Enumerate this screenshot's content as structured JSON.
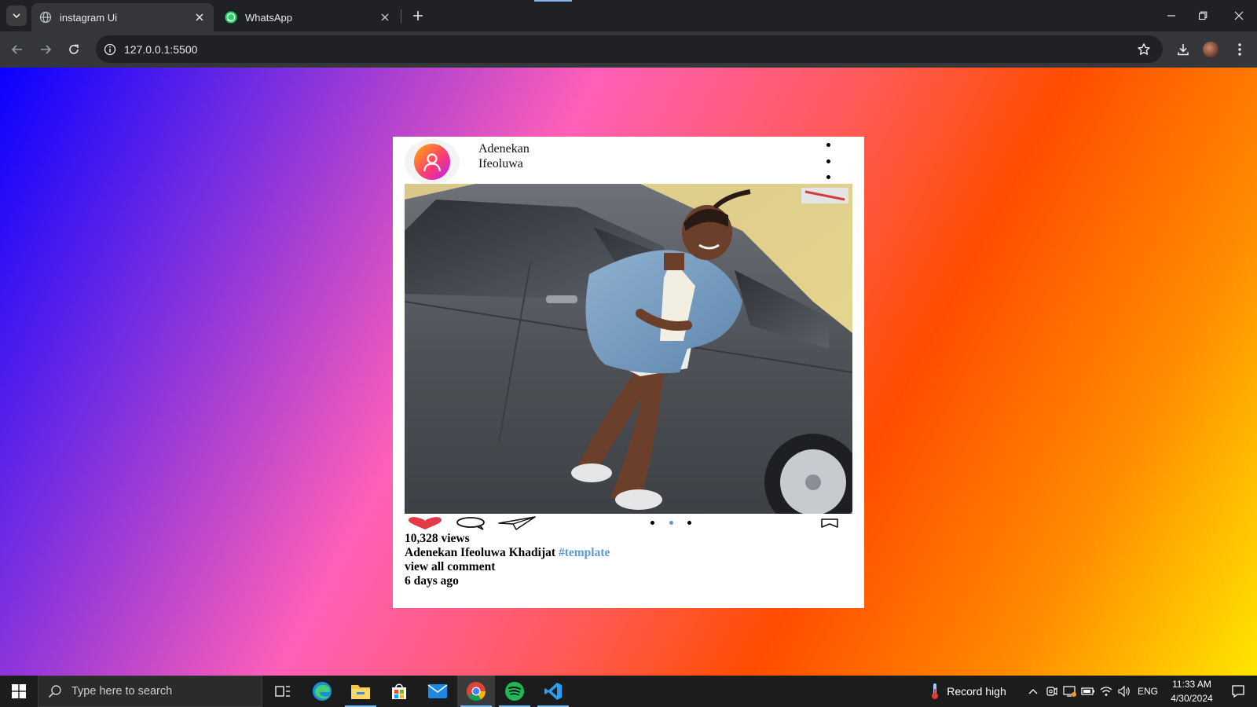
{
  "browser": {
    "tabs": [
      {
        "title": "instagram Ui",
        "active": true,
        "favicon": "globe-icon"
      },
      {
        "title": "WhatsApp",
        "active": false,
        "favicon": "whatsapp-icon"
      }
    ],
    "url": "127.0.0.1:5500"
  },
  "post": {
    "username_line1": "Adenekan",
    "username_line2": "Ifeoluwa",
    "views": "10,328 views",
    "caption_name": "Adenekan Ifeoluwa Khadijat",
    "caption_tag": "#template",
    "view_comments": "view all comment",
    "time_ago": "6 days ago",
    "carousel": {
      "count": 3,
      "active_index": 1
    },
    "photo_description_icon": "photo-of-person-leaning-on-car",
    "colors": {
      "heart": "#e63946",
      "tag": "#5b9bd5"
    }
  },
  "taskbar": {
    "search_placeholder": "Type here to search",
    "weather_text": "Record high",
    "language": "ENG",
    "time": "11:33 AM",
    "date": "4/30/2024"
  },
  "colors": {
    "gradient": [
      "#0a00ff",
      "#7a2fe0",
      "#ff5fb7",
      "#ff4d00",
      "#ff8a00",
      "#ffe600"
    ],
    "chrome_bg": "#202124",
    "toolbar_bg": "#35363a"
  }
}
